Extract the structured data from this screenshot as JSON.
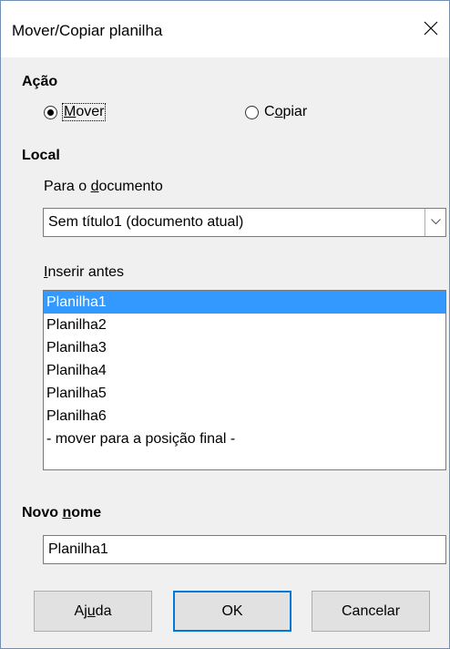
{
  "dialog": {
    "title": "Mover/Copiar planilha",
    "close_label": "close"
  },
  "acao": {
    "heading": "Ação",
    "options": [
      {
        "pre": "",
        "underline": "M",
        "post": "over",
        "checked": true
      },
      {
        "pre": "C",
        "underline": "o",
        "post": "piar",
        "checked": false
      }
    ]
  },
  "local": {
    "heading": "Local",
    "document_label_pre": "Para o ",
    "document_label_u": "d",
    "document_label_post": "ocumento",
    "document_value": "Sem título1 (documento atual)",
    "insert_label_u": "I",
    "insert_label_post": "nserir antes",
    "sheets": [
      {
        "label": "Planilha1",
        "selected": true
      },
      {
        "label": "Planilha2",
        "selected": false
      },
      {
        "label": "Planilha3",
        "selected": false
      },
      {
        "label": "Planilha4",
        "selected": false
      },
      {
        "label": "Planilha5",
        "selected": false
      },
      {
        "label": "Planilha6",
        "selected": false
      },
      {
        "label": "- mover para a posição final -",
        "selected": false
      }
    ]
  },
  "novo_nome": {
    "heading_pre": "Novo ",
    "heading_u": "n",
    "heading_post": "ome",
    "value": "Planilha1"
  },
  "buttons": {
    "help_pre": "Aj",
    "help_u": "u",
    "help_post": "da",
    "ok": "OK",
    "cancel": "Cancelar"
  },
  "colors": {
    "selection": "#3399ff",
    "default_button_border": "#0078d7"
  }
}
